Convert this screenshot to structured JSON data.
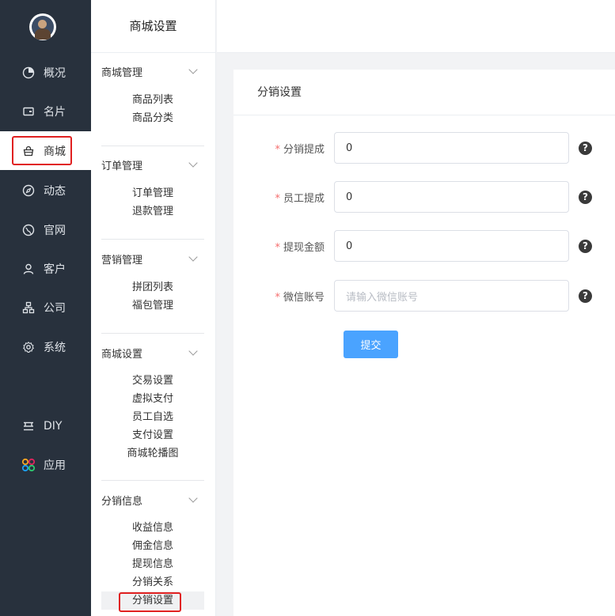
{
  "rail": {
    "items": [
      {
        "label": "概况",
        "icon": "clock-icon"
      },
      {
        "label": "名片",
        "icon": "card-icon"
      },
      {
        "label": "商城",
        "icon": "basket-icon"
      },
      {
        "label": "动态",
        "icon": "compass-icon"
      },
      {
        "label": "官网",
        "icon": "globe-icon"
      },
      {
        "label": "客户",
        "icon": "user-icon"
      },
      {
        "label": "公司",
        "icon": "org-icon"
      },
      {
        "label": "系统",
        "icon": "gear-icon"
      },
      {
        "label": "DIY",
        "icon": "diy-icon"
      },
      {
        "label": "应用",
        "icon": "apps-icon"
      }
    ],
    "active": "商城",
    "accent_color": "#e02020",
    "app_icon_colors": [
      "#f5a623",
      "#e0245e",
      "#1da1f2",
      "#2ecc71"
    ]
  },
  "submenu": {
    "title": "商城设置",
    "groups": [
      {
        "title": "商城管理",
        "items": [
          "商品列表",
          "商品分类"
        ]
      },
      {
        "title": "订单管理",
        "items": [
          "订单管理",
          "退款管理"
        ]
      },
      {
        "title": "营销管理",
        "items": [
          "拼团列表",
          "福包管理"
        ]
      },
      {
        "title": "商城设置",
        "items": [
          "交易设置",
          "虚拟支付",
          "员工自选",
          "支付设置",
          "商城轮播图"
        ]
      },
      {
        "title": "分销信息",
        "items": [
          "收益信息",
          "佣金信息",
          "提现信息",
          "分销关系",
          "分销设置"
        ]
      }
    ],
    "selected": "分销设置"
  },
  "card": {
    "title": "分销设置",
    "required_mark": "*",
    "fields": [
      {
        "label": "分销提成",
        "value": "0",
        "placeholder": ""
      },
      {
        "label": "员工提成",
        "value": "0",
        "placeholder": ""
      },
      {
        "label": "提现金额",
        "value": "0",
        "placeholder": ""
      },
      {
        "label": "微信账号",
        "value": "",
        "placeholder": "请输入微信账号"
      }
    ],
    "help_glyph": "?",
    "submit_label": "提交"
  }
}
